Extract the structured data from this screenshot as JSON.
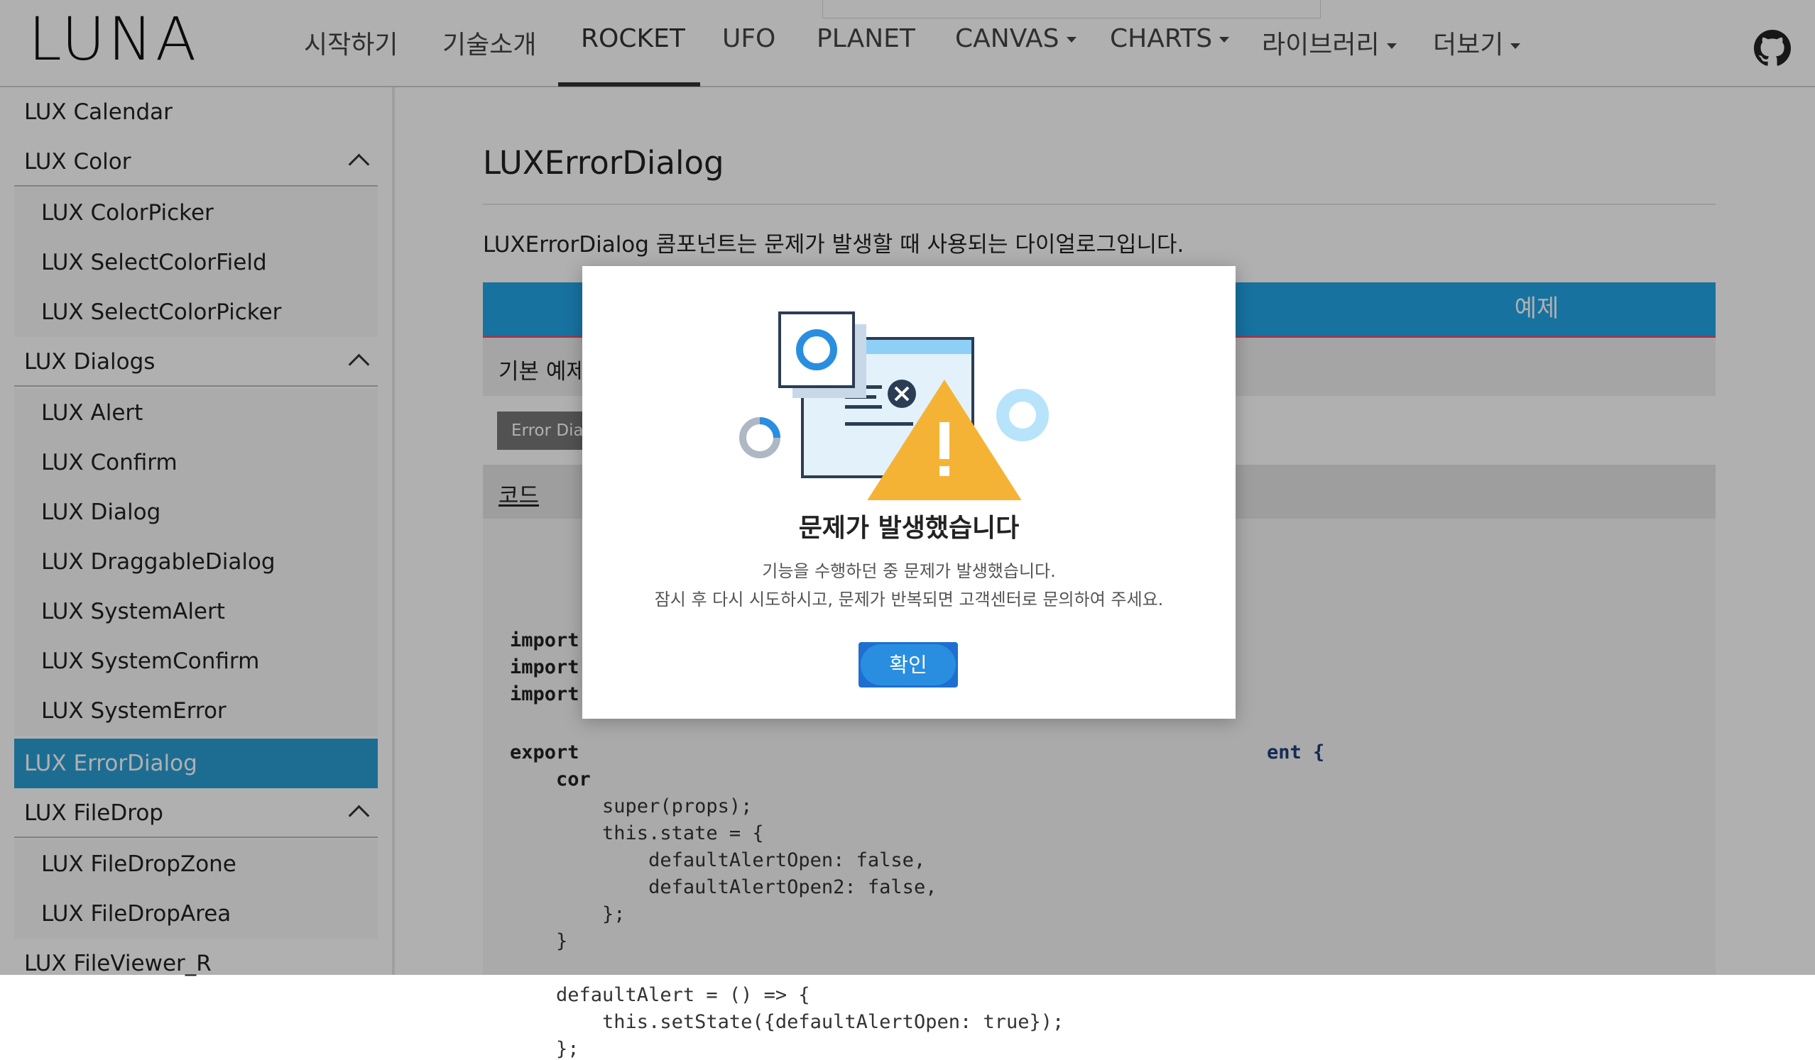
{
  "brand": {
    "logo": "LUNA"
  },
  "nav": {
    "items": [
      {
        "label": "시작하기",
        "dropdown": false
      },
      {
        "label": "기술소개",
        "dropdown": false
      },
      {
        "label": "ROCKET",
        "dropdown": false,
        "active": true
      },
      {
        "label": "UFO",
        "dropdown": false
      },
      {
        "label": "PLANET",
        "dropdown": false
      },
      {
        "label": "CANVAS",
        "dropdown": true
      },
      {
        "label": "CHARTS",
        "dropdown": true
      },
      {
        "label": "라이브러리",
        "dropdown": true
      },
      {
        "label": "더보기",
        "dropdown": true
      }
    ],
    "github_icon": "github-icon"
  },
  "sidebar": {
    "items": [
      {
        "label": "LUX Calendar",
        "type": "item"
      },
      {
        "label": "LUX Color",
        "type": "group",
        "expanded": true
      },
      {
        "label": "LUX ColorPicker",
        "type": "sub"
      },
      {
        "label": "LUX SelectColorField",
        "type": "sub"
      },
      {
        "label": "LUX SelectColorPicker",
        "type": "sub"
      },
      {
        "label": "LUX Dialogs",
        "type": "group",
        "expanded": true
      },
      {
        "label": "LUX Alert",
        "type": "sub"
      },
      {
        "label": "LUX Confirm",
        "type": "sub"
      },
      {
        "label": "LUX Dialog",
        "type": "sub"
      },
      {
        "label": "LUX DraggableDialog",
        "type": "sub"
      },
      {
        "label": "LUX SystemAlert",
        "type": "sub"
      },
      {
        "label": "LUX SystemConfirm",
        "type": "sub"
      },
      {
        "label": "LUX SystemError",
        "type": "sub"
      },
      {
        "label": "LUX ErrorDialog",
        "type": "sub",
        "selected": true
      },
      {
        "label": "LUX FileDrop",
        "type": "group",
        "expanded": true
      },
      {
        "label": "LUX FileDropZone",
        "type": "sub"
      },
      {
        "label": "LUX FileDropArea",
        "type": "sub"
      },
      {
        "label": "LUX FileViewer_R",
        "type": "item"
      }
    ]
  },
  "main": {
    "title": "LUXErrorDialog",
    "description": "LUXErrorDialog 콤포넌트는 문제가 발생할 때 사용되는 다이얼로그입니다.",
    "example_tab": "예제",
    "basic_example": "기본 예제",
    "demo_button": "Error Dialog",
    "code_label": "코드",
    "code_lines": [
      "import",
      "import",
      "import",
      "",
      "export",
      "    cor",
      "        super(props);",
      "        this.state = {",
      "            defaultAlertOpen: false,",
      "            defaultAlertOpen2: false,",
      "        };",
      "    }",
      "",
      "    defaultAlert = () => {",
      "        this.setState({defaultAlertOpen: true});",
      "    };"
    ],
    "code_partial_right": "ent {"
  },
  "dialog": {
    "title": "문제가 발생했습니다",
    "message_line1": "기능을 수행하던 중 문제가 발생했습니다.",
    "message_line2": "잠시 후 다시 시도하시고, 문제가 반복되면 고객센터로 문의하여 주세요.",
    "confirm_label": "확인",
    "illustration_icon": "error-illustration-icon",
    "colors": {
      "accent": "#2a8ee0",
      "warning": "#f5b335",
      "overlay": "rgba(0,0,0,0.31)"
    }
  }
}
